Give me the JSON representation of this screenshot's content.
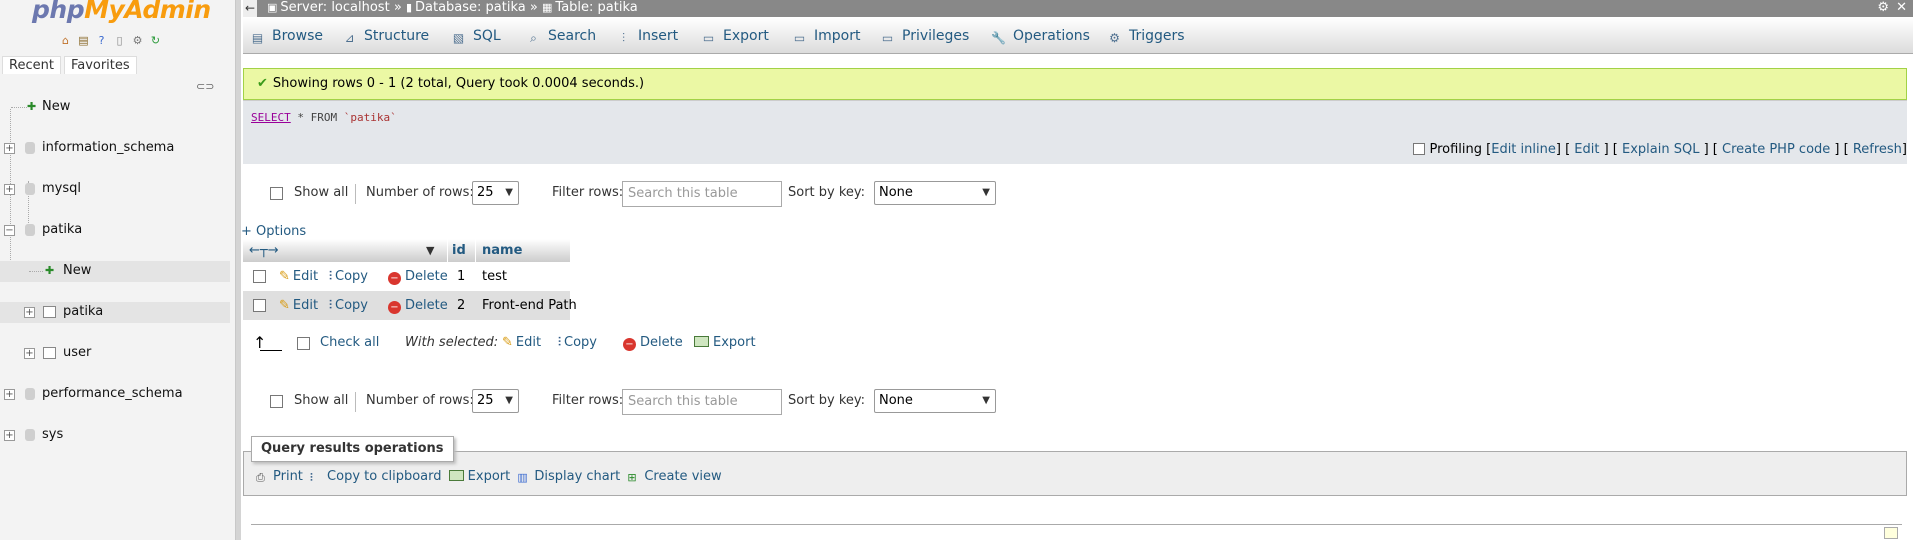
{
  "app": {
    "logo_php": "php",
    "logo_myadmin": "MyAdmin",
    "home_icon": "home-icon",
    "nav_tabs": [
      "Recent",
      "Favorites"
    ]
  },
  "tree": {
    "items": [
      {
        "label": "New",
        "level": 0,
        "kind": "new"
      },
      {
        "label": "information_schema",
        "level": 0,
        "kind": "db"
      },
      {
        "label": "mysql",
        "level": 0,
        "kind": "db"
      },
      {
        "label": "patika",
        "level": 0,
        "kind": "db",
        "expanded": true
      },
      {
        "label": "New",
        "level": 1,
        "kind": "new"
      },
      {
        "label": "patika",
        "level": 1,
        "kind": "table"
      },
      {
        "label": "user",
        "level": 1,
        "kind": "table"
      },
      {
        "label": "performance_schema",
        "level": 0,
        "kind": "db"
      },
      {
        "label": "sys",
        "level": 0,
        "kind": "db"
      }
    ]
  },
  "breadcrumb": {
    "server": "Server: localhost",
    "sep": "»",
    "database": "Database: patika",
    "table": "Table: patika"
  },
  "menu": {
    "tabs": [
      "Browse",
      "Structure",
      "SQL",
      "Search",
      "Insert",
      "Export",
      "Import",
      "Privileges",
      "Operations",
      "Triggers"
    ]
  },
  "result": {
    "message": "Showing rows 0 - 1 (2 total, Query took 0.0004 seconds.)",
    "sql_keyword": "SELECT",
    "sql_rest": " * FROM ",
    "sql_table": "`patika`",
    "profiling": "Profiling",
    "links": [
      "Edit inline",
      "Edit",
      "Explain SQL",
      "Create PHP code",
      "Refresh"
    ]
  },
  "nav_controls": {
    "show_all": "Show all",
    "number_of_rows_label": "Number of rows:",
    "number_of_rows_value": "25",
    "filter_rows_label": "Filter rows:",
    "filter_placeholder": "Search this table",
    "sort_by_key_label": "Sort by key:",
    "sort_by_key_value": "None"
  },
  "options_link": "+ Options",
  "table": {
    "columns": [
      "id",
      "name"
    ],
    "row_actions": {
      "edit": "Edit",
      "copy": "Copy",
      "delete": "Delete"
    },
    "rows": [
      {
        "id": "1",
        "name": "test"
      },
      {
        "id": "2",
        "name": "Front-end Path"
      }
    ]
  },
  "with_selected": {
    "check_all": "Check all",
    "label": "With selected:",
    "edit": "Edit",
    "copy": "Copy",
    "delete": "Delete",
    "export": "Export"
  },
  "query_ops": {
    "legend": "Query results operations",
    "print": "Print",
    "copy_clipboard": "Copy to clipboard",
    "export": "Export",
    "display_chart": "Display chart",
    "create_view": "Create view"
  }
}
